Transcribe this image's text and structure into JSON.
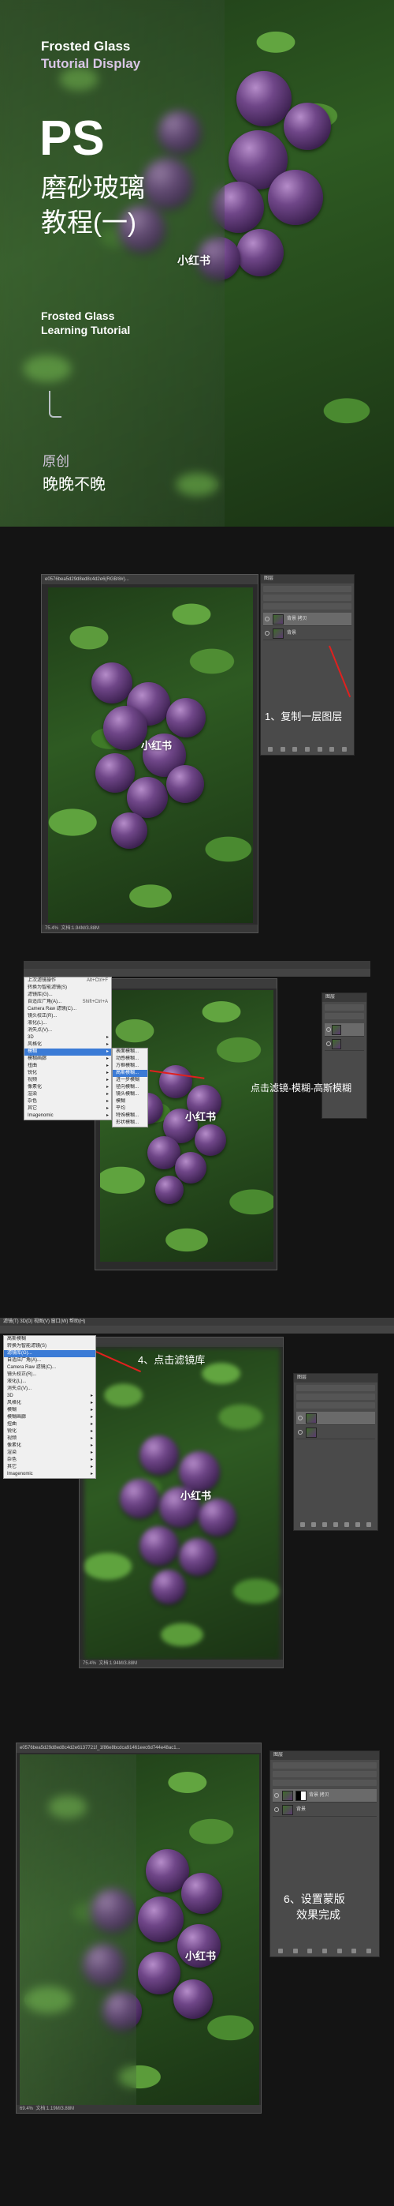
{
  "cover": {
    "title_en_1": "Frosted Glass",
    "title_en_2": "Tutorial Display",
    "ps": "PS",
    "title_cn_1": "磨砂玻璃",
    "title_cn_2": "教程(一)",
    "watermark": "小红书",
    "sub_en_1": "Frosted Glass",
    "sub_en_2": "Learning Tutorial",
    "original_label": "原创",
    "author": "晚晚不晚"
  },
  "step1": {
    "doc_tab": "e0576bea5d29d8ed8c4d2e6(RGB/8#)...",
    "status": "75.4%",
    "status_doc": "文档:1.94M/3.88M",
    "layer_top": "背景 拷贝",
    "layer_bottom": "背景",
    "callout": "1、复制一层图层",
    "watermark": "小红书",
    "layers_title": "图层"
  },
  "step2": {
    "menu": [
      "上次滤镜操作",
      "转换为智能滤镜(S)",
      "滤镜库(G)...",
      "自适应广角(A)...",
      "Camera Raw 滤镜(C)...",
      "镜头校正(R)...",
      "液化(L)...",
      "消失点(V)...",
      "3D",
      "风格化",
      "模糊",
      "模糊画廊",
      "扭曲",
      "锐化",
      "视频",
      "像素化",
      "渲染",
      "杂色",
      "其它",
      "Imagenomic"
    ],
    "submenu": [
      "表面模糊...",
      "动感模糊...",
      "方框模糊...",
      "高斯模糊...",
      "进一步模糊",
      "径向模糊...",
      "镜头模糊...",
      "模糊",
      "平均",
      "特殊模糊...",
      "形状模糊..."
    ],
    "callout": "点击滤镜-模糊-高斯模糊",
    "watermark": "小红书",
    "shortcut_1": "Alt+Ctrl+F",
    "shortcut_2": "Shift+Ctrl+A",
    "layers_title": "图层"
  },
  "step3": {
    "menubar": "滤镜(T) 3D(D) 视图(V) 窗口(W) 帮助(H)",
    "menu": [
      "高斯模糊",
      "转换为智能滤镜(S)",
      "滤镜库(G)...",
      "自适应广角(A)...",
      "Camera Raw 滤镜(C)...",
      "镜头校正(R)...",
      "液化(L)...",
      "消失点(V)...",
      "3D",
      "风格化",
      "模糊",
      "模糊画廊",
      "扭曲",
      "锐化",
      "视频",
      "像素化",
      "渲染",
      "杂色",
      "其它",
      "Imagenomic"
    ],
    "callout": "4、点击滤镜库",
    "watermark": "小红书",
    "status": "75.4%",
    "status_doc": "文档:1.94M/3.88M",
    "layers_title": "图层"
  },
  "step4": {
    "doc_tab": "e0576bea5d29d8ed8c4d2e6137721f_1f86e8bcdca91461eec6d744e48ac1...",
    "callout_1": "6、设置蒙版",
    "callout_2": "效果完成",
    "watermark": "小红书",
    "status": "69.4%",
    "status_doc": "文档:1.19M/3.88M",
    "layer_top": "背景 拷贝",
    "layer_bottom": "背景",
    "layers_title": "图层"
  },
  "colors": {
    "accent_red": "#e0201e",
    "menu_highlight": "#3b7bd6",
    "ps_panel": "#4a4a4a"
  }
}
